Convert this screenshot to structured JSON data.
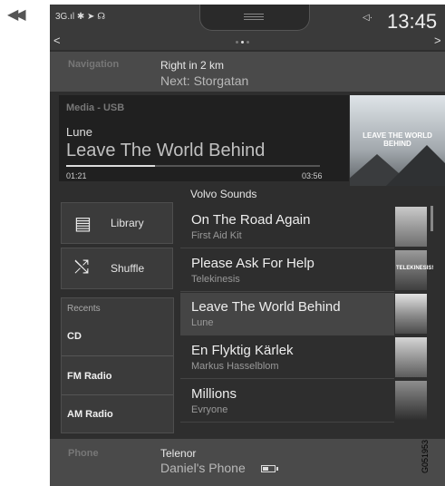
{
  "back_glyph": "◀◀",
  "status": {
    "signal": "3G.ıl ✱ ➤ ☊",
    "volume_glyph": "◁·",
    "time": "13:45",
    "prev_glyph": "<",
    "next_glyph": ">",
    "page_dots": 3,
    "active_dot": 1
  },
  "navigation": {
    "section": "Navigation",
    "line1": "Right in 2 km",
    "line2": "Next: Storgatan"
  },
  "media": {
    "source": "Media - USB",
    "artist": "Lune",
    "track": "Leave The World Behind",
    "elapsed": "01:21",
    "total": "03:56",
    "progress": 0.35,
    "album_text": "LEAVE THE WORLD BEHIND"
  },
  "panel": {
    "library_label": "Library",
    "shuffle_label": "Shuffle",
    "recents_title": "Recents",
    "recents": [
      "CD",
      "FM Radio",
      "AM Radio"
    ]
  },
  "list": {
    "header": "Volvo Sounds",
    "selected_index": 2,
    "items": [
      {
        "title": "On The Road Again",
        "subtitle": "First Aid Kit"
      },
      {
        "title": "Please Ask For Help",
        "subtitle": "Telekinesis"
      },
      {
        "title": "Leave The World Behind",
        "subtitle": "Lune"
      },
      {
        "title": "En Flyktig Kärlek",
        "subtitle": "Markus Hasselblom"
      },
      {
        "title": "Millions",
        "subtitle": "Evryone"
      }
    ],
    "thumb_labels": [
      "",
      "TELEKINESIS!",
      "",
      "",
      ""
    ]
  },
  "phone": {
    "section": "Phone",
    "line1": "Telenor",
    "line2": "Daniel's Phone"
  },
  "figure_code": "G051953"
}
